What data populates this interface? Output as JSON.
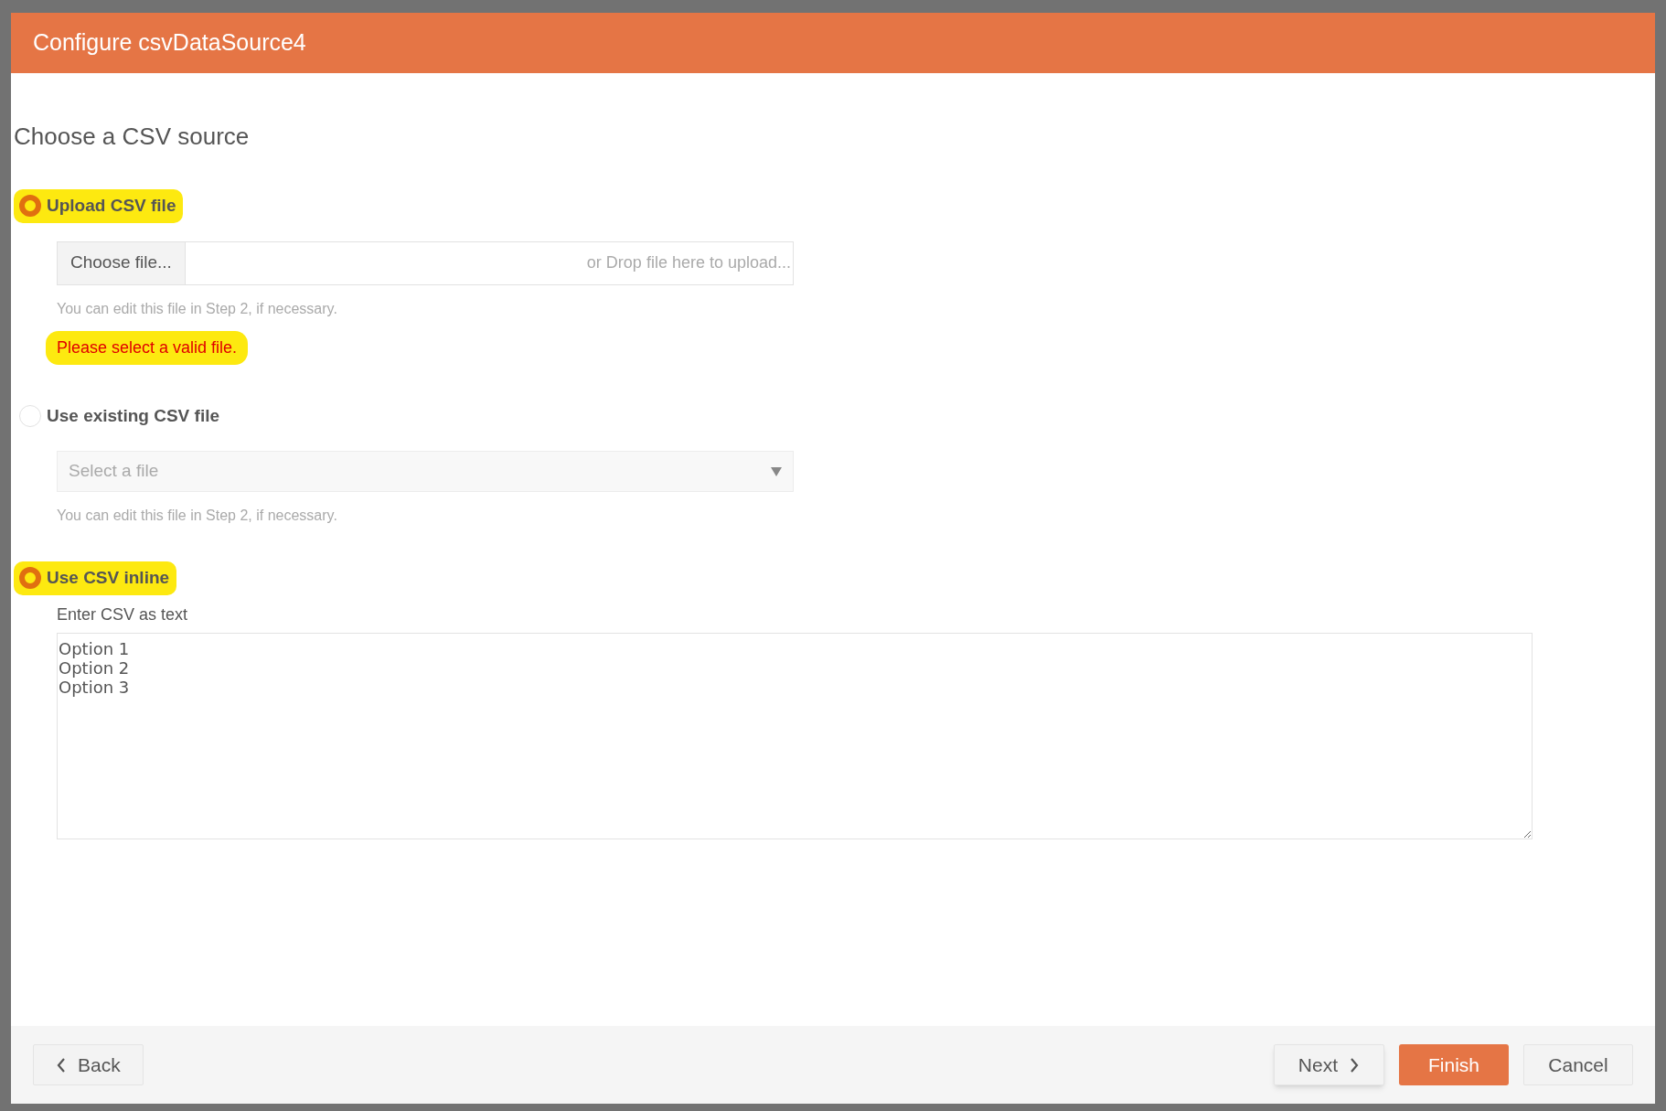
{
  "dialog": {
    "title": "Configure csvDataSource4"
  },
  "heading": "Choose a CSV source",
  "sources": [
    {
      "kind": "upload",
      "label": "Upload CSV file",
      "selected": true,
      "highlighted": true,
      "button": "Choose file...",
      "drop_hint": "or Drop file here to upload...",
      "help": "You can edit this file in Step 2, if necessary.",
      "error": "Please select a valid file.",
      "error_highlighted": true
    },
    {
      "kind": "select",
      "label": "Use existing CSV file",
      "selected": false,
      "highlighted": false,
      "placeholder": "Select a file",
      "help": "You can edit this file in Step 2, if necessary."
    },
    {
      "kind": "inline",
      "label": "Use CSV inline",
      "selected": true,
      "highlighted": true,
      "field_label": "Enter CSV as text",
      "value": "Option 1\nOption 2\nOption 3"
    }
  ],
  "footer": {
    "back": "Back",
    "next": "Next",
    "finish": "Finish",
    "cancel": "Cancel"
  }
}
